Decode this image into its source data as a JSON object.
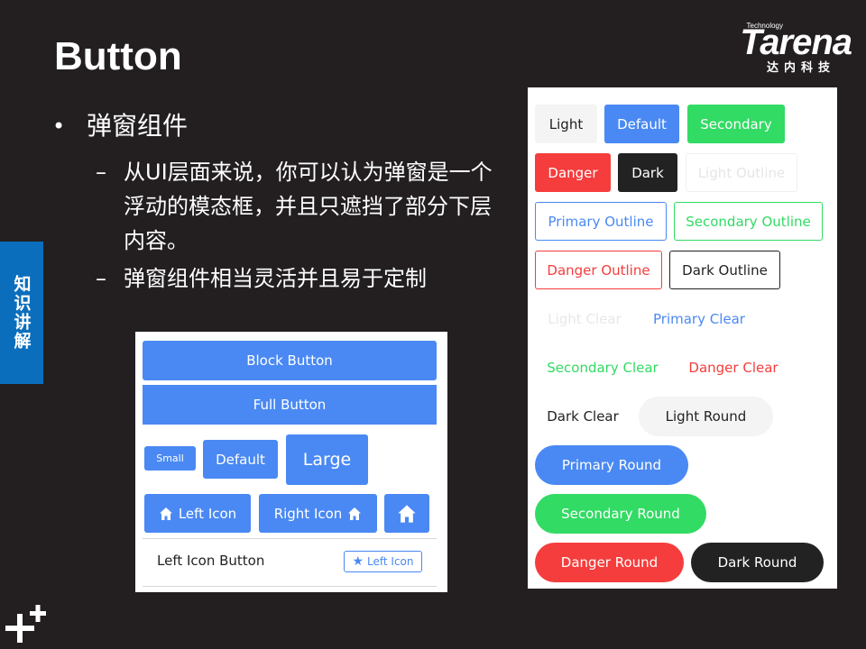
{
  "slide": {
    "title": "Button",
    "side_tab": "知识讲解",
    "bullet1": "弹窗组件",
    "sub1": "从UI层面来说，你可以认为弹窗是一个浮动的模态框，并且只遮挡了部分下层内容。",
    "sub2": "弹窗组件相当灵活并且易于定制"
  },
  "brand": {
    "small": "Technology",
    "name": "Tarena",
    "cn": "达内科技"
  },
  "left_panel": {
    "block_button": "Block Button",
    "full_button": "Full Button",
    "small": "Small",
    "default": "Default",
    "large": "Large",
    "left_icon": "Left Icon",
    "right_icon": "Right Icon",
    "item_label": "Left Icon Button",
    "item_button": "Left Icon",
    "icons": {
      "home": "home-icon",
      "star": "star-icon"
    }
  },
  "right_panel": {
    "light": "Light",
    "default": "Default",
    "secondary": "Secondary",
    "danger": "Danger",
    "dark": "Dark",
    "light_outline": "Light Outline",
    "primary_outline": "Primary Outline",
    "secondary_outline": "Secondary Outline",
    "danger_outline": "Danger Outline",
    "dark_outline": "Dark Outline",
    "light_clear": "Light Clear",
    "primary_clear": "Primary Clear",
    "secondary_clear": "Secondary Clear",
    "danger_clear": "Danger Clear",
    "dark_clear": "Dark Clear",
    "light_round": "Light Round",
    "primary_round": "Primary Round",
    "secondary_round": "Secondary Round",
    "danger_round": "Danger Round",
    "dark_round": "Dark Round"
  },
  "colors": {
    "primary": "#4a89f3",
    "secondary": "#32db64",
    "danger": "#f53d3d",
    "dark": "#222222",
    "light": "#f4f4f4",
    "slide_bg": "#231f20",
    "side_tab": "#0a6ebd"
  }
}
